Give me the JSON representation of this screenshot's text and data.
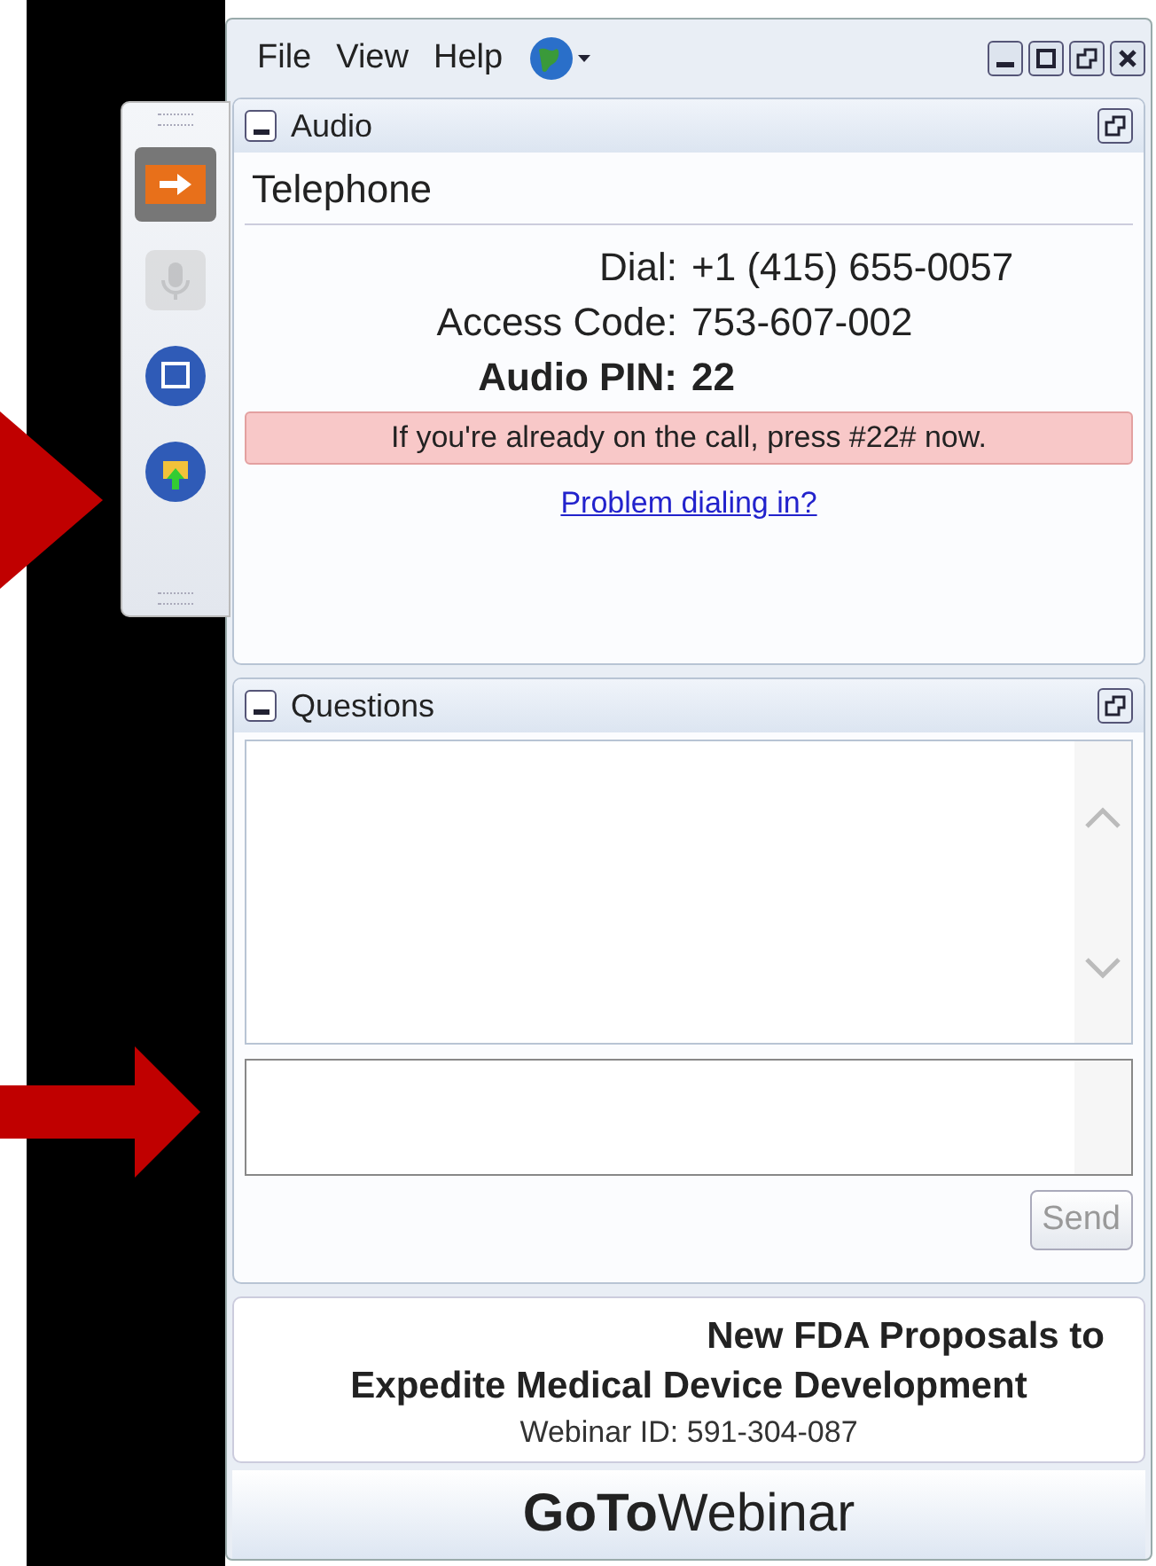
{
  "menu": [
    "File",
    "View",
    "Help"
  ],
  "toolbar": [
    {
      "kind": "arrow",
      "disabled": false
    },
    {
      "kind": "mic",
      "disabled": true
    },
    {
      "kind": "screen",
      "disabled": false
    },
    {
      "kind": "hand",
      "disabled": false
    }
  ],
  "audio": {
    "title": "Audio",
    "expanded": true,
    "mode": "Telephone",
    "details": [
      {
        "label": "Dial:",
        "value": "+1 (415) 655-0057",
        "bold": false
      },
      {
        "label": "Access Code:",
        "value": "753-607-002",
        "bold": false
      },
      {
        "label": "Audio PIN:",
        "value": "22",
        "bold": true
      }
    ],
    "notice": "If you're already on the call, press #22# now.",
    "link": "Problem dialing in?"
  },
  "questions": {
    "title": "Questions",
    "expanded": true,
    "send": {
      "label": "Send",
      "disabled": true
    }
  },
  "webinar": {
    "title_lines": [
      "New FDA Proposals to",
      "Expedite Medical Device Development"
    ],
    "id": "Webinar ID: 591-304-087"
  },
  "logo": "**GoTo**Webinar"
}
